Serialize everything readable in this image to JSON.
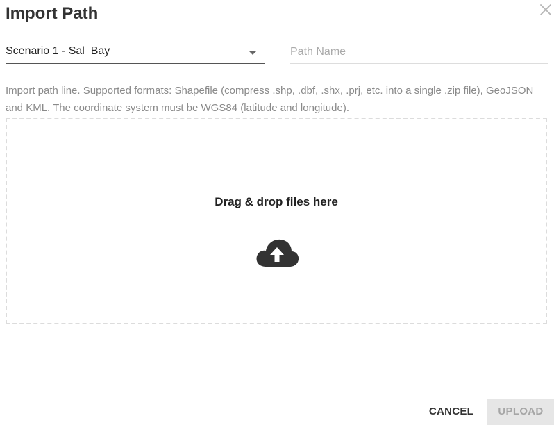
{
  "dialog": {
    "title": "Import Path",
    "close_icon": "close-icon"
  },
  "form": {
    "scenario_select": {
      "selected": "Scenario 1 - Sal_Bay",
      "caret_icon": "caret-down-icon"
    },
    "path_name": {
      "placeholder": "Path Name",
      "value": ""
    },
    "helper_text": "Import path line. Supported formats: Shapefile (compress .shp, .dbf, .shx, .prj, etc. into a single .zip file), GeoJSON and KML. The coordinate system must be WGS84 (latitude and longitude)."
  },
  "dropzone": {
    "label": "Drag & drop files here",
    "icon": "cloud-upload-icon"
  },
  "actions": {
    "cancel_label": "CANCEL",
    "upload_label": "UPLOAD",
    "upload_enabled": false
  },
  "colors": {
    "title": "#333333",
    "helper_text": "#8a8a8a",
    "dropzone_border": "#dcdcdc",
    "upload_disabled_bg": "#e6e6e6",
    "upload_disabled_text": "#a6a6a6"
  }
}
